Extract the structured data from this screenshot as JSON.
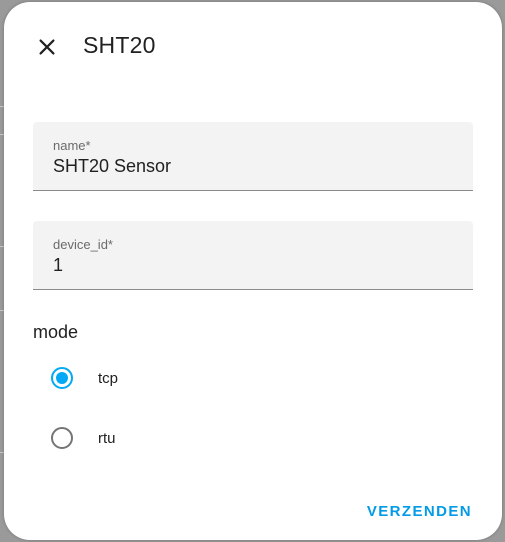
{
  "dialog": {
    "title": "SHT20",
    "close_icon": "close-icon"
  },
  "fields": {
    "name": {
      "label": "name*",
      "value": "SHT20 Sensor"
    },
    "device_id": {
      "label": "device_id*",
      "value": "1"
    }
  },
  "mode": {
    "label": "mode",
    "options": [
      {
        "label": "tcp",
        "checked": true
      },
      {
        "label": "rtu",
        "checked": false
      }
    ]
  },
  "actions": {
    "submit_label": "VERZENDEN"
  },
  "colors": {
    "accent": "#03a9f4",
    "field_bg": "#f3f3f3",
    "text": "#212121"
  }
}
